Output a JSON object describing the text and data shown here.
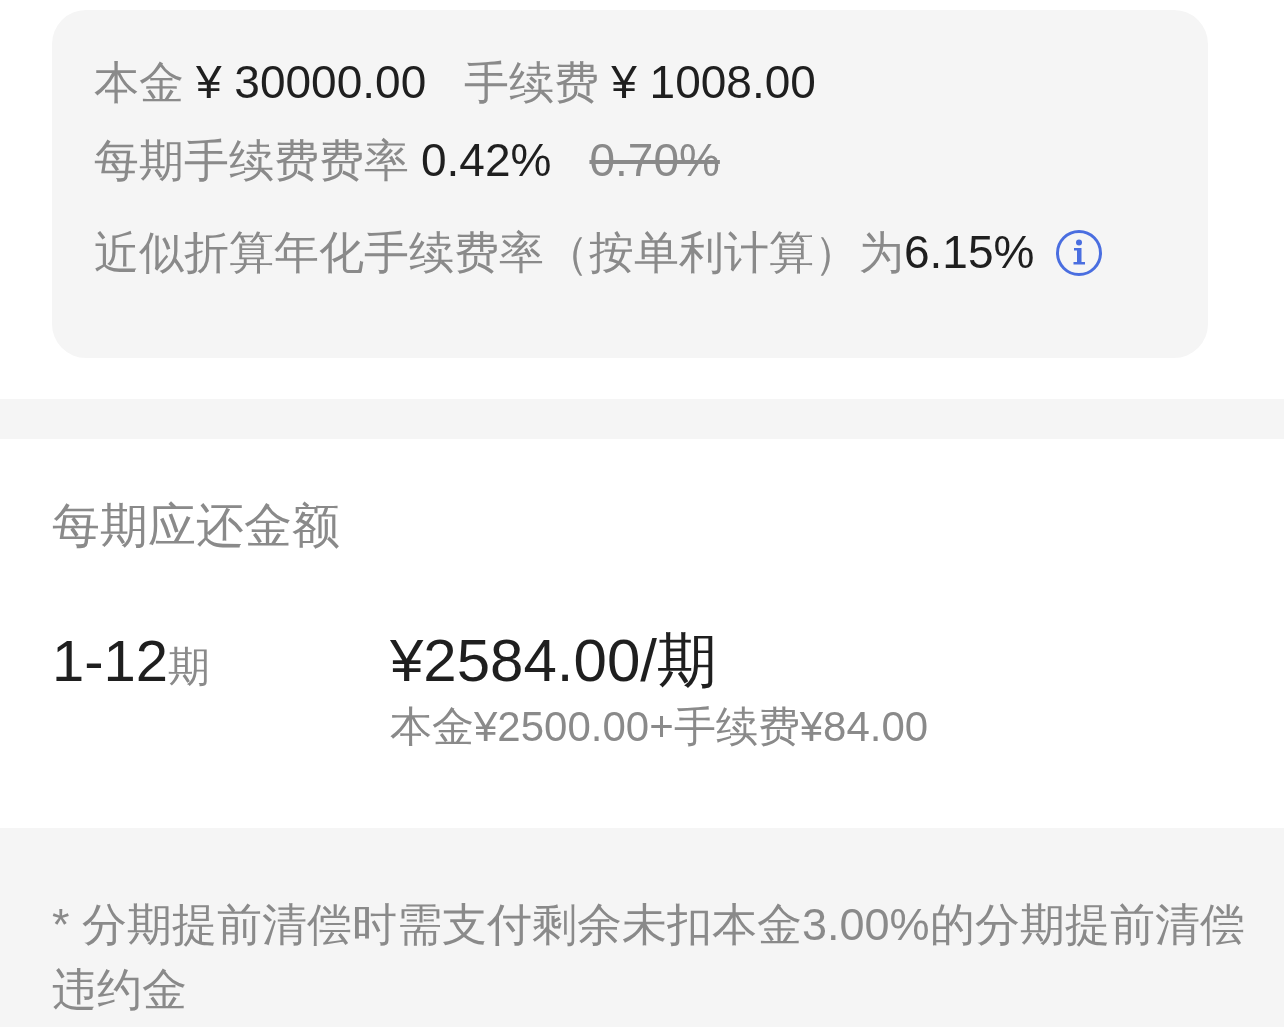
{
  "summary_card": {
    "principal": {
      "label": "本金",
      "value": "¥ 30000.00"
    },
    "fee": {
      "label": "手续费",
      "value": "¥ 1008.00"
    },
    "rate": {
      "label": "每期手续费费率",
      "value": "0.42%",
      "original_value": "0.70%"
    },
    "annual_rate": {
      "label": "近似折算年化手续费率（按单利计算）为",
      "value": "6.15%"
    }
  },
  "repayment": {
    "title": "每期应还金额",
    "rows": [
      {
        "periods": "1-12",
        "unit": "期",
        "amount": "¥2584.00/期",
        "breakdown": "本金¥2500.00+手续费¥84.00"
      }
    ]
  },
  "footnote": "* 分期提前清偿时需支付剩余未扣本金3.00%的分期提前清偿违约金"
}
